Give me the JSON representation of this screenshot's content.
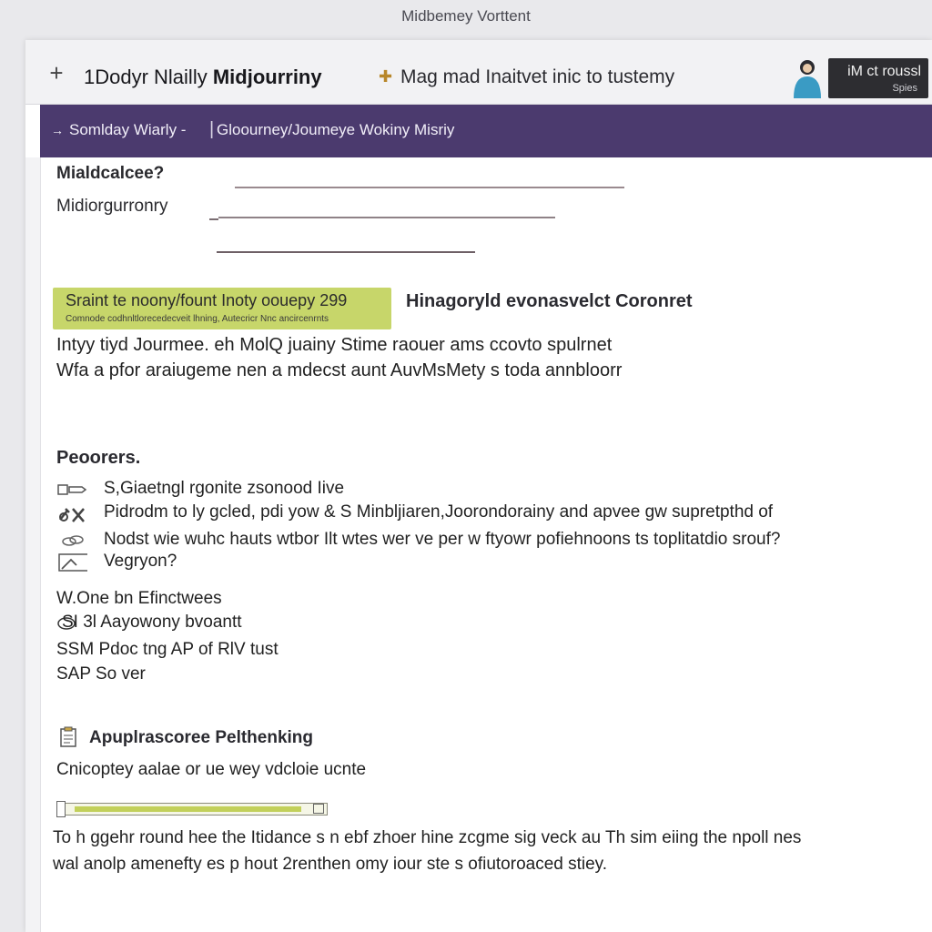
{
  "window": {
    "title": "Midbemey Vorttent"
  },
  "header": {
    "app_title_prefix": "1Dodyr Nlailly ",
    "app_title_bold": "Midjourriny",
    "tagline": "Mag mad Inaitvet inic to tustemy",
    "account_line1": "iM ct roussl",
    "account_line2": "Spies"
  },
  "nav": {
    "item1": "Somlday Wiarly -",
    "separator": "|",
    "item2": "Gloourney/Joumeye Wokiny Misriy"
  },
  "form": {
    "heading": "Mialdcalcee?",
    "field_label": "Midiorgurronry"
  },
  "callout": {
    "main": "Sraint te noony/fount Inoty oouepy 299",
    "sub": "Comnode codhnltlorecedecveit lhning, Autecricr Nnc ancircenrnts",
    "heading": "Hinagoryld evonasvelct Coronret"
  },
  "intro": {
    "line1": "Intyy tiyd Jourmee. eh MolQ juainy Stime raouer ams ccovto spulrnet",
    "line2": "Wfa  a pfor araiugeme nen a mdecst aunt AuvMsMety s toda annbloorr"
  },
  "process": {
    "heading": "Peoorers.",
    "items": [
      {
        "icon": "tag-icon",
        "text": "S,Giaetngl rgonite zsonood Iive"
      },
      {
        "icon": "tools-icon",
        "text": "Pidrodm to ly gcled, pdi yow & S Minbljiaren,Joorondorainy and apvee gw supretpthd of"
      },
      {
        "icon": "link-icon",
        "text": "Nodst wie wuhc hauts wtbor Ilt wtes wer ve per w ftyowr pofiehnoons ts toplitatdio srouf?"
      },
      {
        "icon": "chart-icon",
        "text": "Vegryon?"
      }
    ],
    "plain_lines": [
      "W.One bn Efinctwees",
      "SI 3l Aayowony bvoantt",
      "SSM  Pdoc tng AP of RlV tust",
      "SAP  So ver"
    ],
    "second_line_icon": "mouse-icon"
  },
  "approach": {
    "heading": "Apuplrascoree Pelthenking",
    "icon": "clipboard-icon",
    "text": "Cnicoptey aalae or ue wey vdcloie ucnte",
    "progress": 0.95
  },
  "footer": {
    "line1": "To h ggehr round hee the Itidance s n ebf zhoer hine zcgme sig veck au Th sim eiing the npoll nes",
    "line2": "wal anolp amenefty es p hout  2renthen omy iour ste s ofiutoroaced stiey."
  },
  "colors": {
    "nav_bg": "#4b3a6e",
    "highlight": "#c7d66a",
    "account_bg": "#2d2d31",
    "avatar": "#3a9bc4"
  }
}
